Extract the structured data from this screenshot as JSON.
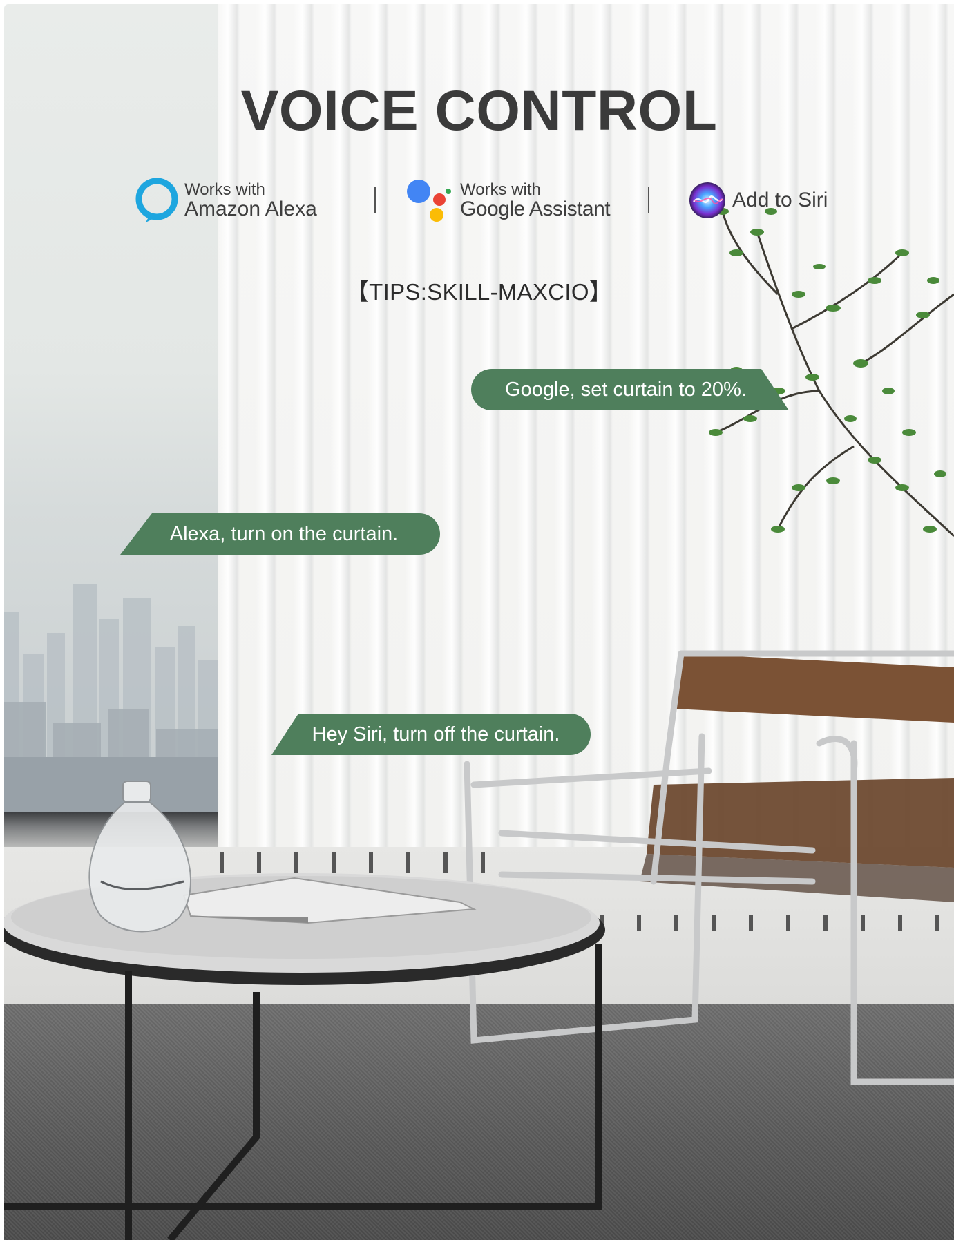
{
  "title": "VOICE CONTROL",
  "badges": {
    "alexa": {
      "line1": "Works with",
      "line2": "Amazon Alexa",
      "icon": "alexa-ring-icon",
      "color": "#1ea6df"
    },
    "google": {
      "line1": "Works with",
      "line2": "Google Assistant",
      "icon": "google-assistant-dots-icon",
      "colors": [
        "#4285f4",
        "#ea4335",
        "#fbbc05",
        "#34a853"
      ]
    },
    "siri": {
      "label": "Add to Siri",
      "icon": "siri-orb-icon"
    }
  },
  "tips": "【TIPS:SKILL-MAXCIO】",
  "bubbles": {
    "google": "Google, set curtain to 20%.",
    "alexa": "Alexa, turn on the curtain.",
    "siri": "Hey Siri, turn off the curtain."
  },
  "colors": {
    "bubble": "#4f7f5c",
    "title": "#3b3b3b"
  }
}
